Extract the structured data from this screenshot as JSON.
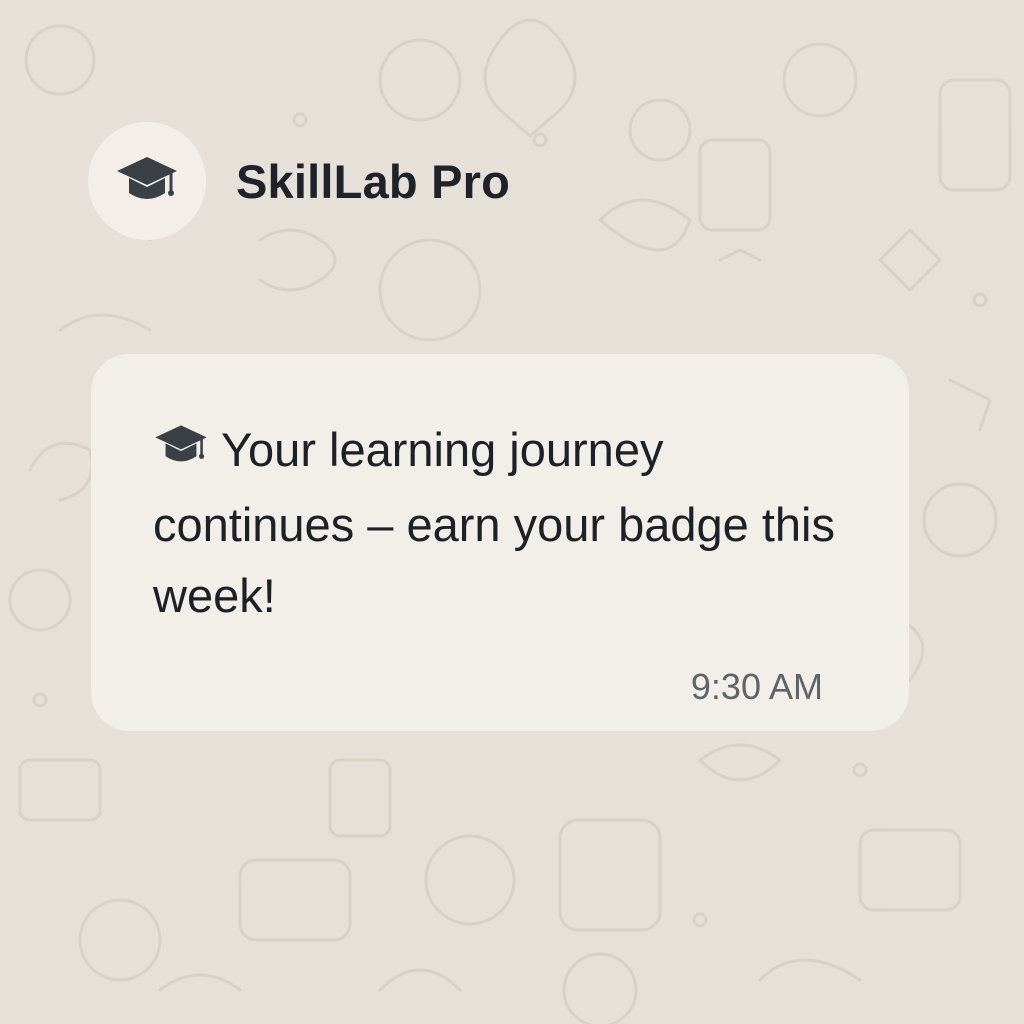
{
  "chat": {
    "sender_name": "SkillLab Pro",
    "avatar_icon": "graduation-cap-icon"
  },
  "message": {
    "icon": "graduation-cap-icon",
    "text": "Your learning journey continues – earn your badge this week!",
    "time": "9:30 AM"
  },
  "colors": {
    "background": "#e7e0d8",
    "bubble": "#f2eee8",
    "text": "#1c2027",
    "icon": "#3b3f46"
  }
}
